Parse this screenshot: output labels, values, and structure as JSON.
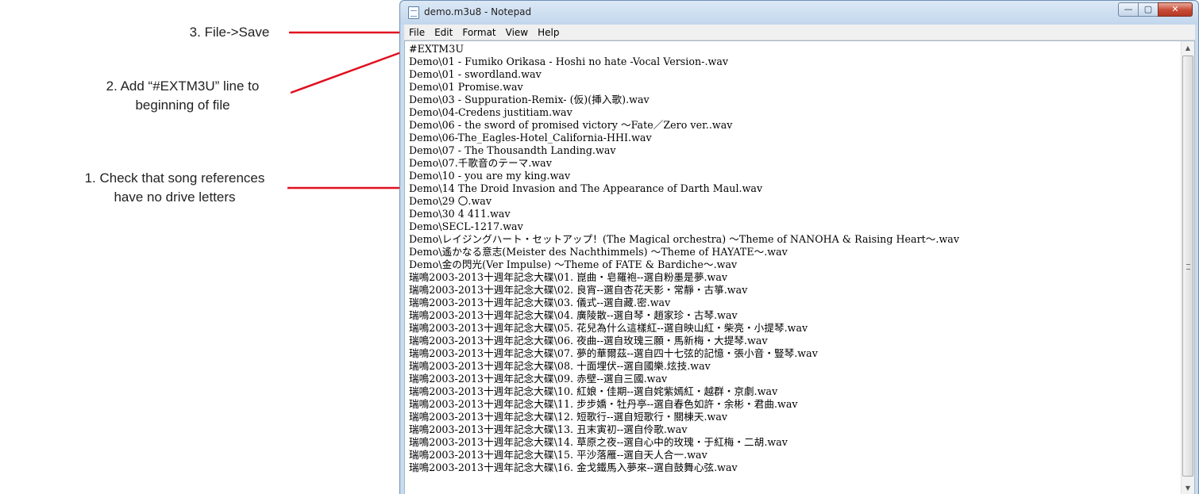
{
  "annotations": [
    {
      "lines": [
        "3. File->Save"
      ]
    },
    {
      "lines": [
        "2. Add “#EXTM3U” line to",
        "beginning of file"
      ]
    },
    {
      "lines": [
        "1. Check that song references",
        "have no drive letters"
      ]
    }
  ],
  "colors": {
    "arrow": "#e01020"
  },
  "window": {
    "title": "demo.m3u8 - Notepad",
    "controls": {
      "minimize": "—",
      "maximize": "▢",
      "close": "✕"
    }
  },
  "menu": [
    "File",
    "Edit",
    "Format",
    "View",
    "Help"
  ],
  "icons": {
    "app": "notepad-icon",
    "scroll_up": "▲",
    "scroll_down": "▼"
  },
  "lines": [
    "#EXTM3U",
    "Demo\\01 - Fumiko Orikasa - Hoshi no hate -Vocal Version-.wav",
    "Demo\\01 - swordland.wav",
    "Demo\\01 Promise.wav",
    "Demo\\03 - Suppuration-Remix- (仮)(挿入歌).wav",
    "Demo\\04-Credens justitiam.wav",
    "Demo\\06 - the sword of promised victory ～Fate／Zero ver..wav",
    "Demo\\06-The_Eagles-Hotel_California-HHI.wav",
    "Demo\\07 - The Thousandth Landing.wav",
    "Demo\\07.千歌音のテーマ.wav",
    "Demo\\10 - you are my king.wav",
    "Demo\\14 The Droid Invasion and The Appearance of Darth Maul.wav",
    "Demo\\29 〇.wav",
    "Demo\\30 4 411.wav",
    "Demo\\SECL-1217.wav",
    "Demo\\レイジングハート・セットアップ！(The Magical orchestra) ～Theme of NANOHA & Raising Heart～.wav",
    "Demo\\遙かなる意志(Meister des Nachthimmels) ～Theme of HAYATE～.wav",
    "Demo\\金の閃光(Ver Impulse) ～Theme of FATE & Bardiche～.wav",
    "瑞鳴2003-2013十週年記念大碟\\01. 崑曲・皂羅袍--選自粉墨是夢.wav",
    "瑞鳴2003-2013十週年記念大碟\\02. 良宵--選自杏花天影・常靜・古箏.wav",
    "瑞鳴2003-2013十週年記念大碟\\03. 儀式--選自藏.密.wav",
    "瑞鳴2003-2013十週年記念大碟\\04. 廣陵散--選自琴・趙家珍・古琴.wav",
    "瑞鳴2003-2013十週年記念大碟\\05. 花兒為什么這樣紅--選自映山紅・柴亮・小提琴.wav",
    "瑞鳴2003-2013十週年記念大碟\\06. 夜曲--選自玫瑰三願・馬新梅・大提琴.wav",
    "瑞鳴2003-2013十週年記念大碟\\07. 夢的華爾茲--選自四十七弦的記憶・張小音・豎琴.wav",
    "瑞鳴2003-2013十週年記念大碟\\08. 十面埋伏--選自國樂.炫技.wav",
    "瑞鳴2003-2013十週年記念大碟\\09. 赤壁--選自三國.wav",
    "瑞鳴2003-2013十週年記念大碟\\10. 紅娘・佳期--選自姹紫嫣紅・越群・京劇.wav",
    "瑞鳴2003-2013十週年記念大碟\\11. 步步嬌・牡丹亭--選自春色如許・余彬・君曲.wav",
    "瑞鳴2003-2013十週年記念大碟\\12. 短歌行--選自短歌行・關棟天.wav",
    "瑞鳴2003-2013十週年記念大碟\\13. 丑末寅初--選自伶歌.wav",
    "瑞鳴2003-2013十週年記念大碟\\14. 草原之夜--選自心中的玫瑰・于紅梅・二胡.wav",
    "瑞鳴2003-2013十週年記念大碟\\15. 平沙落雁--選自天人合一.wav",
    "瑞鳴2003-2013十週年記念大碟\\16. 金戈鐵馬入夢來--選自鼓舞心弦.wav"
  ]
}
